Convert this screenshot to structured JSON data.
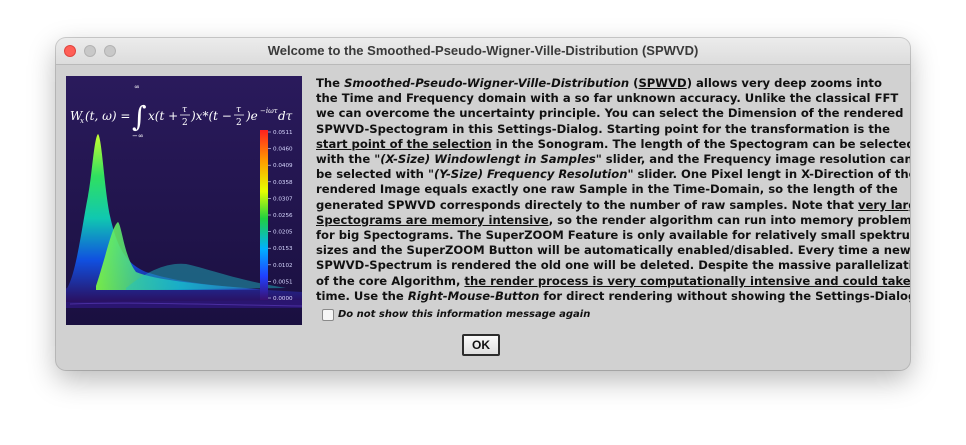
{
  "window": {
    "title": "Welcome to the Smoothed-Pseudo-Wigner-Ville-Distribution (SPWVD)"
  },
  "figure": {
    "formula": "W_x(t,ω) = ∫ x(t+τ/2) x*(t−τ/2) e^{−iωτ} dτ",
    "colorbar_ticks": [
      "0.0511",
      "0.0460",
      "0.0409",
      "0.0358",
      "0.0307",
      "0.0256",
      "0.0205",
      "0.0153",
      "0.0102",
      "0.0051",
      "0.0000"
    ]
  },
  "body": {
    "lines": [
      [
        {
          "t": "The "
        },
        {
          "t": "Smoothed-Pseudo-Wigner-Ville-Distribution",
          "s": "i"
        },
        {
          "t": " ("
        },
        {
          "t": "SPWVD",
          "s": "u"
        },
        {
          "t": ") allows very deep zooms into"
        }
      ],
      [
        {
          "t": "the Time and Frequency domain with a so far unknown accuracy. Unlike the classical FFT"
        }
      ],
      [
        {
          "t": "we can overcome the uncertainty principle. You can select the Dimension of the rendered"
        }
      ],
      [
        {
          "t": "SPWVD-Spectogram in this Settings-Dialog. Starting point for the transformation is the"
        }
      ],
      [
        {
          "t": "start point of the selection",
          "s": "u"
        },
        {
          "t": " in the Sonogram. The length of the Spectogram can be selected"
        }
      ],
      [
        {
          "t": "with the "
        },
        {
          "t": "\"(X-Size) Windowlengt in Samples\"",
          "s": "i"
        },
        {
          "t": " slider, and the Frequency image resolution can"
        }
      ],
      [
        {
          "t": "be selected with "
        },
        {
          "t": "\"(Y-Size) Frequency Resolution\"",
          "s": "i"
        },
        {
          "t": " slider. One Pixel lengt in X-Direction of the"
        }
      ],
      [
        {
          "t": "rendered Image equals exactly one raw Sample in the Time-Domain, so the length of the"
        }
      ],
      [
        {
          "t": "generated SPWVD corresponds directely to the number of raw samples. Note that "
        },
        {
          "t": "very large",
          "s": "u"
        }
      ],
      [
        {
          "t": "Spectograms are memory intensive",
          "s": "u"
        },
        {
          "t": ", so the render algorithm can run into memory problems"
        }
      ],
      [
        {
          "t": "for big Spectograms. The SuperZOOM Feature is only available for relatively small spektrum"
        }
      ],
      [
        {
          "t": "sizes and the SuperZOOM Button will be automatically enabled/disabled. Every time a new"
        }
      ],
      [
        {
          "t": "SPWVD-Spectrum is rendered the old one will be deleted. Despite the massive parallelization"
        }
      ],
      [
        {
          "t": "of the core Algorithm, "
        },
        {
          "t": "the render process is very computationally intensive and could take",
          "s": "u"
        },
        {
          "t": "."
        }
      ],
      [
        {
          "t": "time. Use the "
        },
        {
          "t": "Right-Mouse-Button",
          "s": "i"
        },
        {
          "t": " for direct rendering without showing the Settings-Dialog."
        }
      ]
    ]
  },
  "checkbox": {
    "label": "Do not show this information message again",
    "checked": false
  },
  "buttons": {
    "ok": "OK"
  }
}
